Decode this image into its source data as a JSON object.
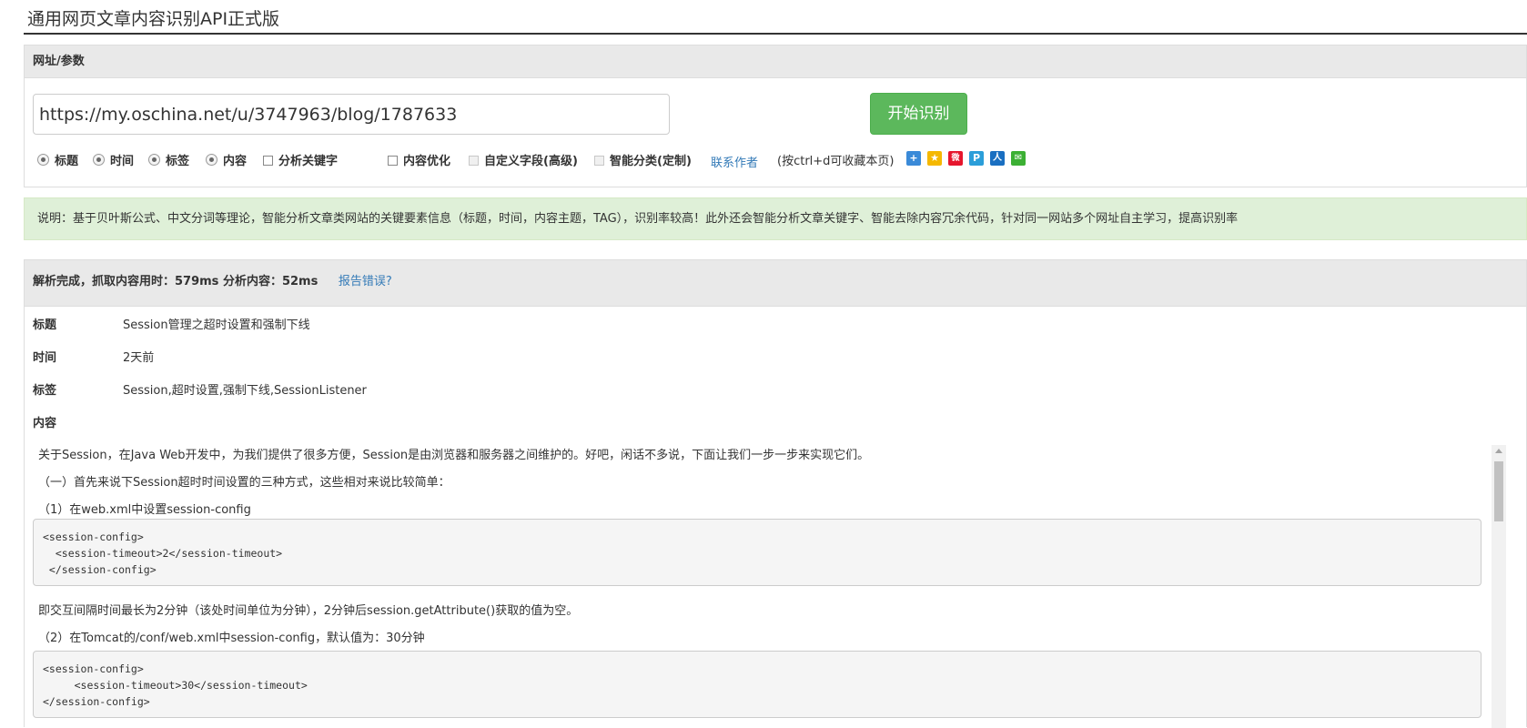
{
  "page_title": "通用网页文章内容识别API正式版",
  "params_panel": {
    "header": "网址/参数",
    "url_value": "https://my.oschina.net/u/3747963/blog/1787633",
    "start_button": "开始识别",
    "options": [
      {
        "label": "标题",
        "kind": "radio",
        "checked": true
      },
      {
        "label": "时间",
        "kind": "radio",
        "checked": true
      },
      {
        "label": "标签",
        "kind": "radio",
        "checked": true
      },
      {
        "label": "内容",
        "kind": "radio",
        "checked": true
      },
      {
        "label": "分析关键字",
        "kind": "checkbox",
        "checked": false
      },
      {
        "label": "内容优化",
        "kind": "checkbox",
        "checked": false
      },
      {
        "label": "自定义字段(高级)",
        "kind": "checkbox",
        "checked": false,
        "disabled": true
      },
      {
        "label": "智能分类(定制)",
        "kind": "checkbox",
        "checked": false,
        "disabled": true
      }
    ],
    "contact_link": "联系作者",
    "bookmark_hint": "(按ctrl+d可收藏本页)",
    "share_icons": [
      {
        "name": "add-share-icon",
        "color": "#3a8ad8",
        "glyph": "+"
      },
      {
        "name": "qzone-share-icon",
        "color": "#f5b800",
        "glyph": "★"
      },
      {
        "name": "weibo-share-icon",
        "color": "#e6162d",
        "glyph": "微"
      },
      {
        "name": "tencent-share-icon",
        "color": "#2b9ed9",
        "glyph": "P"
      },
      {
        "name": "renren-share-icon",
        "color": "#1a6fc1",
        "glyph": "人"
      },
      {
        "name": "wechat-share-icon",
        "color": "#3cb034",
        "glyph": "✉"
      }
    ]
  },
  "description": "说明：基于贝叶斯公式、中文分词等理论，智能分析文章类网站的关键要素信息（标题，时间，内容主题，TAG），识别率较高！此外还会智能分析文章关键字、智能去除内容冗余代码，针对同一网站多个网址自主学习，提高识别率",
  "result_panel": {
    "status": "解析完成，抓取内容用时：579ms 分析内容：52ms",
    "report_link": "报告错误?",
    "fields": [
      {
        "label": "标题",
        "value": "Session管理之超时设置和强制下线"
      },
      {
        "label": "时间",
        "value": "2天前"
      },
      {
        "label": "标签",
        "value": "Session,超时设置,强制下线,SessionListener"
      },
      {
        "label": "内容",
        "value": ""
      }
    ],
    "content": {
      "para1": "关于Session，在Java Web开发中，为我们提供了很多方便，Session是由浏览器和服务器之间维护的。好吧，闲话不多说，下面让我们一步一步来实现它们。",
      "para2": "（一）首先来说下Session超时时间设置的三种方式，这些相对来说比较简单：",
      "para3": "（1）在web.xml中设置session-config",
      "code1": "<session-config>\n  <session-timeout>2</session-timeout>\n </session-config>",
      "para4": "即交互间隔时间最长为2分钟（该处时间单位为分钟），2分钟后session.getAttribute()获取的值为空。",
      "para5": "（2）在Tomcat的/conf/web.xml中session-config，默认值为：30分钟",
      "code2": "<session-config>\n     <session-timeout>30</session-timeout>\n</session-config>"
    }
  }
}
